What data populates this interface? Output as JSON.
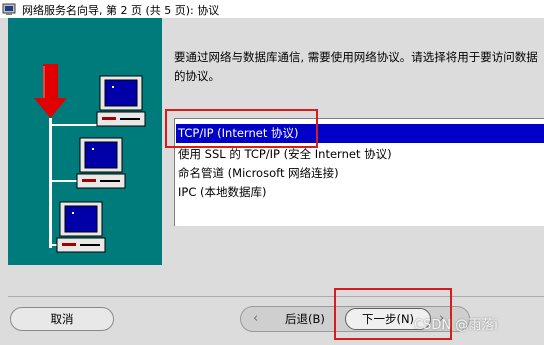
{
  "window": {
    "title": "网络服务名向导, 第 2 页 (共 5 页): 协议",
    "icon": "oracle-wizard-icon"
  },
  "intro": {
    "line1": "要通过网络与数据库通信, 需要使用网络协议。请选择将用于要访问数据",
    "line2": "的协议。"
  },
  "protocols": [
    {
      "label": "TCP/IP (Internet 协议)",
      "selected": true
    },
    {
      "label": "使用 SSL 的 TCP/IP (安全 Internet 协议)",
      "selected": false
    },
    {
      "label": "命名管道 (Microsoft 网络连接)",
      "selected": false
    },
    {
      "label": "IPC (本地数据库)",
      "selected": false
    }
  ],
  "buttons": {
    "cancel": "取消",
    "back": "后退(B)",
    "next": "下一步(N)"
  },
  "watermark": "CSDN @雨落i",
  "colors": {
    "illustration_bg": "#007b7b",
    "selection": "#0000c8",
    "highlight": "#d81c1c"
  }
}
